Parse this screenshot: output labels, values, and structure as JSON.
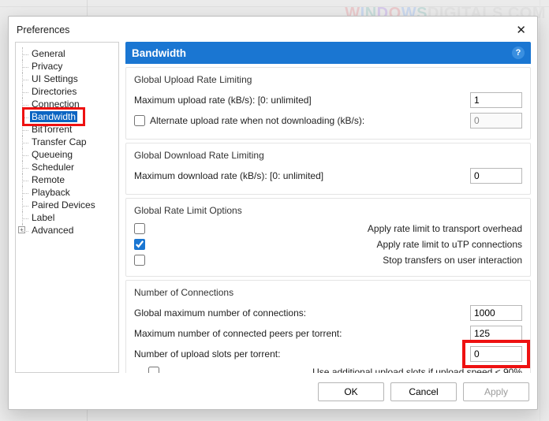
{
  "watermark": "WindowsDigitals.com",
  "dialog": {
    "title": "Preferences"
  },
  "tree": {
    "items": [
      "General",
      "Privacy",
      "UI Settings",
      "Directories",
      "Connection",
      "Bandwidth",
      "BitTorrent",
      "Transfer Cap",
      "Queueing",
      "Scheduler",
      "Remote",
      "Playback",
      "Paired Devices",
      "Label",
      "Advanced"
    ],
    "selected_index": 5,
    "expandable_index": 14
  },
  "panel": {
    "title": "Bandwidth"
  },
  "upload": {
    "section": "Global Upload Rate Limiting",
    "max_label": "Maximum upload rate (kB/s): [0: unlimited]",
    "max_value": "1",
    "alt_label": "Alternate upload rate when not downloading (kB/s):",
    "alt_checked": false,
    "alt_value": "0",
    "alt_disabled": true
  },
  "download": {
    "section": "Global Download Rate Limiting",
    "max_label": "Maximum download rate (kB/s): [0: unlimited]",
    "max_value": "0"
  },
  "limits": {
    "section": "Global Rate Limit Options",
    "opt1_label": "Apply rate limit to transport overhead",
    "opt1_checked": false,
    "opt2_label": "Apply rate limit to uTP connections",
    "opt2_checked": true,
    "opt3_label": "Stop transfers on user interaction",
    "opt3_checked": false
  },
  "conn": {
    "section": "Number of Connections",
    "global_label": "Global maximum number of connections:",
    "global_value": "1000",
    "peers_label": "Maximum number of connected peers per torrent:",
    "peers_value": "125",
    "slots_label": "Number of upload slots per torrent:",
    "slots_value": "0",
    "extra_label": "Use additional upload slots if upload speed < 90%",
    "extra_checked": false
  },
  "buttons": {
    "ok": "OK",
    "cancel": "Cancel",
    "apply": "Apply"
  }
}
